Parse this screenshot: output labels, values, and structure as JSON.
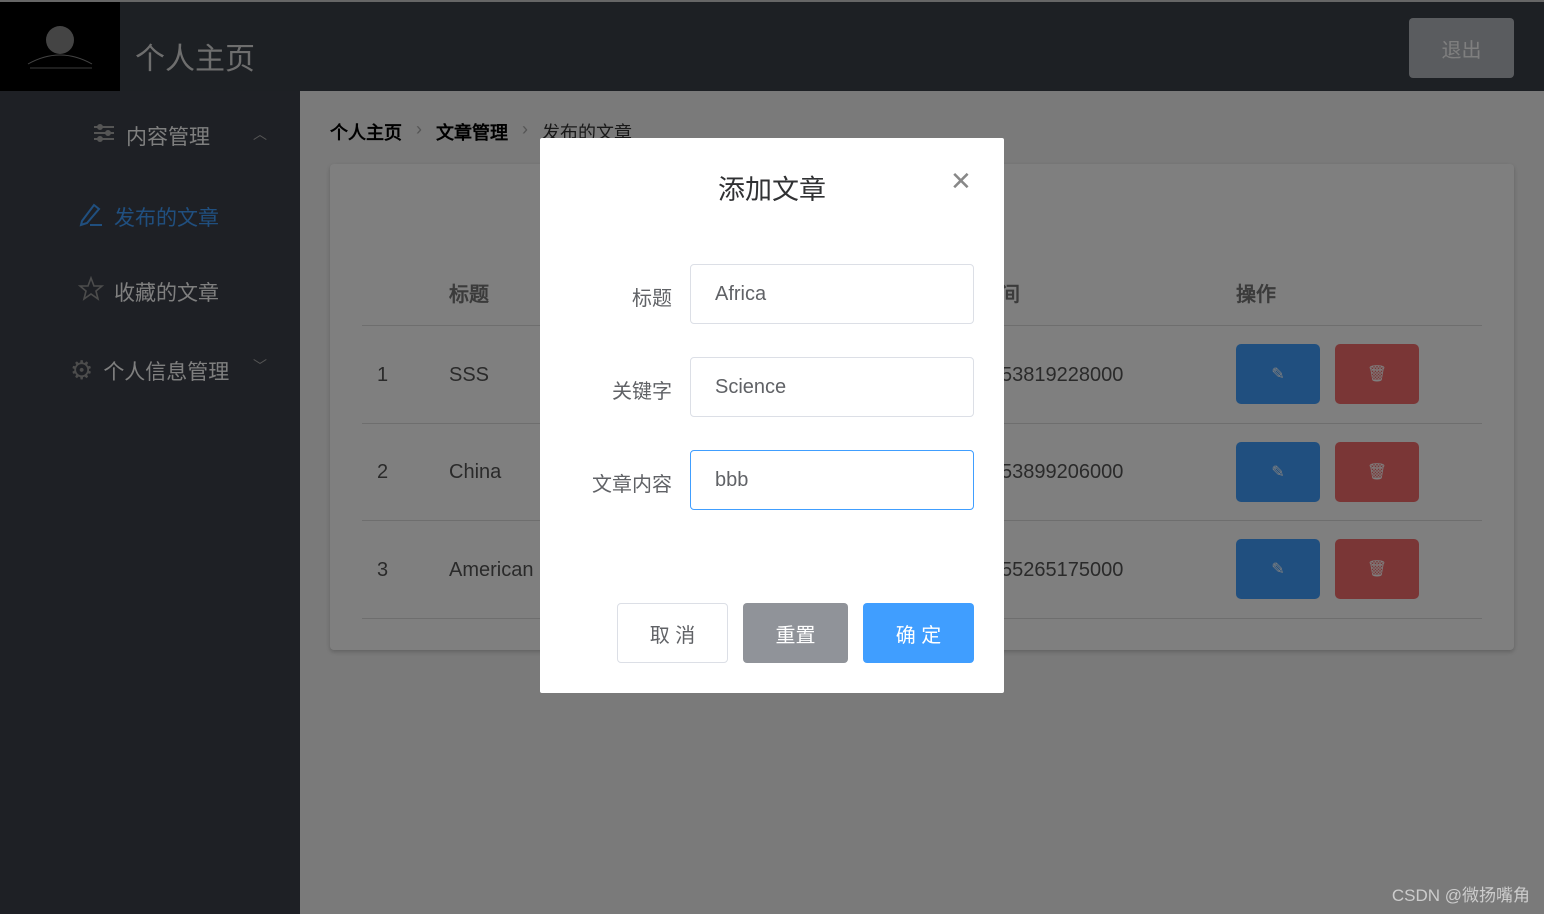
{
  "header": {
    "title": "个人主页",
    "logout": "退出"
  },
  "sidebar": {
    "items": [
      {
        "label": "内容管理",
        "icon": "sliders-icon"
      },
      {
        "label": "发布的文章",
        "icon": "edit-icon",
        "active": true
      },
      {
        "label": "收藏的文章",
        "icon": "star-icon"
      },
      {
        "label": "个人信息管理",
        "icon": "gear-icon"
      }
    ]
  },
  "breadcrumb": [
    "个人主页",
    "文章管理",
    "发布的文章"
  ],
  "table": {
    "headers": {
      "title": "标题",
      "time": "间",
      "actions": "操作"
    },
    "rows": [
      {
        "index": "1",
        "title": "SSS",
        "time": "53819228000"
      },
      {
        "index": "2",
        "title": "China",
        "time": "53899206000"
      },
      {
        "index": "3",
        "title": "American",
        "time": "55265175000"
      }
    ]
  },
  "dialog": {
    "title": "添加文章",
    "fields": [
      {
        "label": "标题",
        "value": "Africa"
      },
      {
        "label": "关键字",
        "value": "Science"
      },
      {
        "label": "文章内容",
        "value": "bbb"
      }
    ],
    "cancel": "取 消",
    "reset": "重置",
    "confirm": "确 定"
  },
  "watermark": "CSDN @微扬嘴角",
  "colors": {
    "primary": "#409eff",
    "danger": "#f56c6c"
  }
}
